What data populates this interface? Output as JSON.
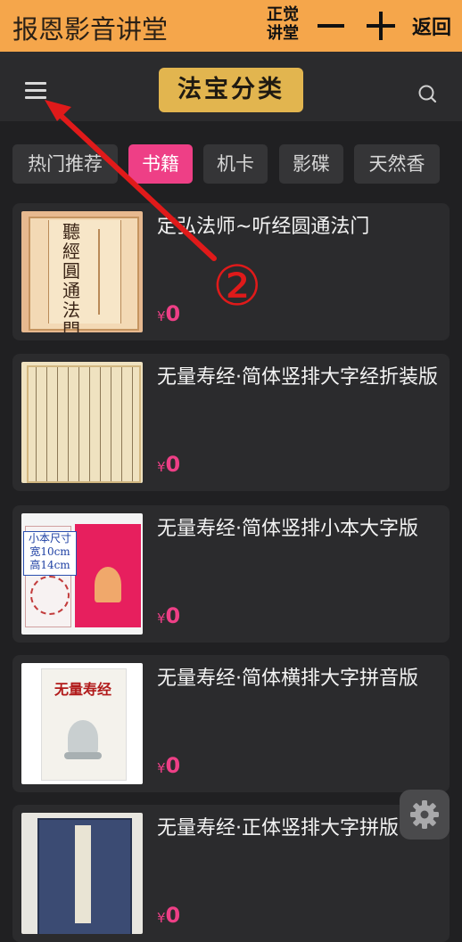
{
  "topbar": {
    "title": "报恩影音讲堂",
    "logo_line1": "正觉",
    "logo_line2": "讲堂",
    "back_label": "返回"
  },
  "header": {
    "title": "法宝分类"
  },
  "tabs": [
    {
      "label": "热门推荐",
      "active": false
    },
    {
      "label": "书籍",
      "active": true
    },
    {
      "label": "机卡",
      "active": false
    },
    {
      "label": "影碟",
      "active": false
    },
    {
      "label": "天然香",
      "active": false
    }
  ],
  "books": [
    {
      "title": "定弘法师~听经圆通法门",
      "price_symbol": "¥",
      "price": "0",
      "cover_text": "聽經圓通法門"
    },
    {
      "title": "无量寿经·简体竖排大字经折装版",
      "price_symbol": "¥",
      "price": "0"
    },
    {
      "title": "无量寿经·简体竖排小本大字版",
      "price_symbol": "¥",
      "price": "0",
      "cover_label_1": "小本尺寸",
      "cover_label_2": "宽10cm",
      "cover_label_3": "高14cm"
    },
    {
      "title": "无量寿经·简体横排大字拼音版",
      "price_symbol": "¥",
      "price": "0",
      "cover_text": "无量寿经"
    },
    {
      "title": "无量寿经·正体竖排大字拼版",
      "price_symbol": "¥",
      "price": "0"
    }
  ],
  "annotation": {
    "number": "②"
  },
  "colors": {
    "topbar": "#f5a64b",
    "accent": "#ee3f86",
    "title_badge": "#e2b54f",
    "annotation": "#e01a1a",
    "background": "#202022"
  }
}
